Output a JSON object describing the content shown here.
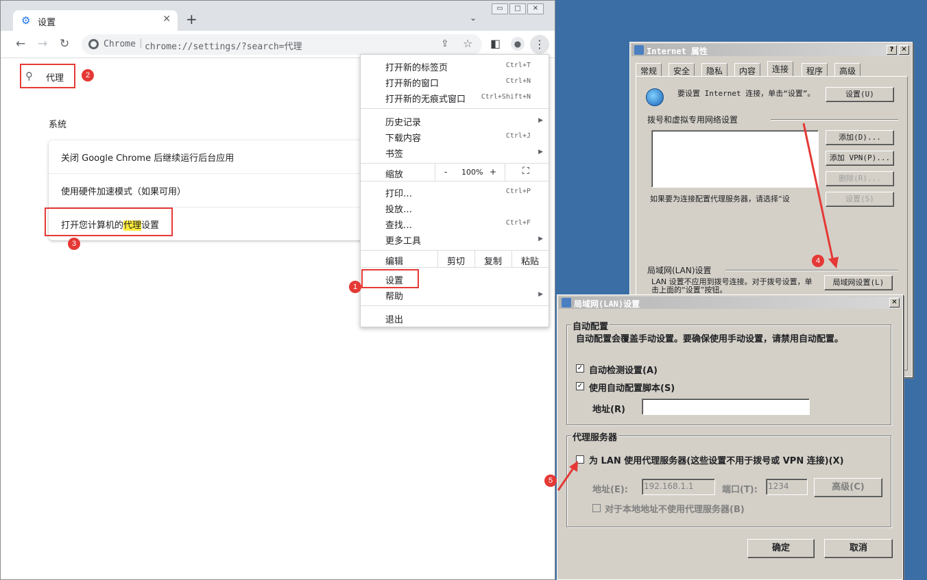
{
  "browser": {
    "tab_title": "设置",
    "tab_close": "✕",
    "new_tab": "+",
    "tab_search": "⌄",
    "win_buttons": [
      "▭",
      "□",
      "✕"
    ],
    "omnibox": {
      "site": "Chrome",
      "sep": "|",
      "url": "chrome://settings/?search=代理"
    },
    "search": {
      "query": "代理"
    },
    "section_title": "系统",
    "rows": [
      {
        "label": "关闭 Google Chrome 后继续运行后台应用"
      },
      {
        "label": "使用硬件加速模式（如果可用）"
      },
      {
        "pre": "打开您计算机的",
        "hl": "代理",
        "post": "设置"
      }
    ],
    "menu": {
      "new_tab": {
        "label": "打开新的标签页",
        "shortcut": "Ctrl+T"
      },
      "new_window": {
        "label": "打开新的窗口",
        "shortcut": "Ctrl+N"
      },
      "incognito": {
        "label": "打开新的无痕式窗口",
        "shortcut": "Ctrl+Shift+N"
      },
      "history": {
        "label": "历史记录"
      },
      "downloads": {
        "label": "下载内容",
        "shortcut": "Ctrl+J"
      },
      "bookmarks": {
        "label": "书签"
      },
      "zoom": {
        "label": "缩放",
        "minus": "-",
        "value": "100%",
        "plus": "+"
      },
      "print": {
        "label": "打印…",
        "shortcut": "Ctrl+P"
      },
      "cast": {
        "label": "投放…"
      },
      "find": {
        "label": "查找…",
        "shortcut": "Ctrl+F"
      },
      "more_tools": {
        "label": "更多工具"
      },
      "edit": {
        "label": "编辑",
        "cut": "剪切",
        "copy": "复制",
        "paste": "粘贴"
      },
      "settings": {
        "label": "设置"
      },
      "help": {
        "label": "帮助"
      },
      "exit": {
        "label": "退出"
      }
    }
  },
  "internet_properties": {
    "title": "Internet 属性",
    "title_buttons": [
      "?",
      "✕"
    ],
    "tabs": [
      "常规",
      "安全",
      "隐私",
      "内容",
      "连接",
      "程序",
      "高级"
    ],
    "active_tab": "连接",
    "setup_text": "要设置 Internet 连接，单击“设置”。",
    "setup_button": "设置(U)",
    "dialup_label": "拨号和虚拟专用网络设置",
    "add_button": "添加(D)...",
    "add_vpn_button": "添加 VPN(P)...",
    "remove_button": "删除(R)...",
    "settings_button": "设置(S)",
    "proxy_hint": "如果要为连接配置代理服务器，请选择“设",
    "lan_label": "局域网(LAN)设置",
    "lan_desc": "LAN 设置不应用到拨号连接。对于拨号设置，单击上面的“设置”按钮。",
    "lan_button": "局域网设置(L)"
  },
  "lan_dialog": {
    "title": "局域网(LAN)设置",
    "close": "✕",
    "auto_group": "自动配置",
    "auto_desc": "自动配置会覆盖手动设置。要确保使用手动设置，请禁用自动配置。",
    "auto_detect": {
      "label": "自动检测设置(A)",
      "checked": true
    },
    "auto_script": {
      "label": "使用自动配置脚本(S)",
      "checked": true
    },
    "address_label": "地址(R)",
    "address_value": "",
    "proxy_group": "代理服务器",
    "use_proxy": {
      "label": "为 LAN 使用代理服务器(这些设置不用于拨号或 VPN 连接)(X)",
      "checked": false
    },
    "proxy_address_label": "地址(E):",
    "proxy_address_value": "192.168.1.1",
    "port_label": "端口(T):",
    "port_value": "1234",
    "advanced_button": "高级(C)",
    "bypass_local": {
      "label": "对于本地地址不使用代理服务器(B)",
      "checked": false
    },
    "ok_button": "确定",
    "cancel_button": "取消"
  },
  "annotations": [
    "1",
    "2",
    "3",
    "4",
    "5"
  ],
  "colors": {
    "accent_red": "#e53935",
    "chrome_blue": "#1a73e8",
    "desktop": "#3a6ea5",
    "highlight": "#ffeb3b"
  }
}
